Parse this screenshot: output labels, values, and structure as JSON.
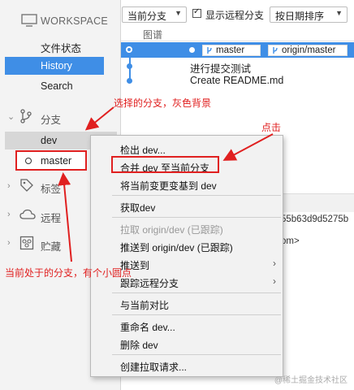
{
  "sidebar": {
    "workspace_label": "WORKSPACE",
    "nav": [
      "文件状态",
      "History",
      "Search"
    ],
    "branches_label": "分支",
    "branches": [
      "dev",
      "master"
    ],
    "tags_label": "标签",
    "remotes_label": "远程",
    "stash_label": "贮藏"
  },
  "toolbar": {
    "branch_select": "当前分支",
    "show_remote_label": "显示远程分支",
    "show_remote_checked": true,
    "sort_select": "按日期排序"
  },
  "graph": {
    "column_header": "图谱",
    "commits": [
      {
        "badges": [
          "master",
          "origin/master"
        ],
        "message": ""
      },
      {
        "badges": [],
        "message": "进行提交测试"
      },
      {
        "badges": [],
        "message": "Create README.md"
      }
    ]
  },
  "detail": {
    "hash_fragment": "55b63d9d5275b",
    "author_fragment": "om>"
  },
  "context_menu": {
    "items": [
      {
        "label": "检出 dev...",
        "disabled": false
      },
      {
        "label": "合并 dev 至当前分支",
        "disabled": false
      },
      {
        "label": "将当前变更变基到 dev",
        "disabled": false
      },
      {
        "label": "获取dev",
        "disabled": false
      },
      {
        "label": "拉取 origin/dev (已跟踪)",
        "disabled": true
      },
      {
        "label": "推送到 origin/dev (已跟踪)",
        "disabled": false
      },
      {
        "label": "推送到",
        "disabled": false
      },
      {
        "label": "跟踪远程分支",
        "disabled": false
      },
      {
        "label": "与当前对比",
        "disabled": false
      },
      {
        "label": "重命名 dev...",
        "disabled": false
      },
      {
        "label": "删除 dev",
        "disabled": false
      },
      {
        "label": "创建拉取请求...",
        "disabled": false
      }
    ]
  },
  "annotations": {
    "selected_branch": "选择的分支，灰色背景",
    "click": "点击",
    "current_branch": "当前处于的分支，有个小圆点"
  },
  "colors": {
    "accent": "#3f8ee6",
    "annotation": "#e02020"
  },
  "watermark": "@稀土掘金技术社区"
}
